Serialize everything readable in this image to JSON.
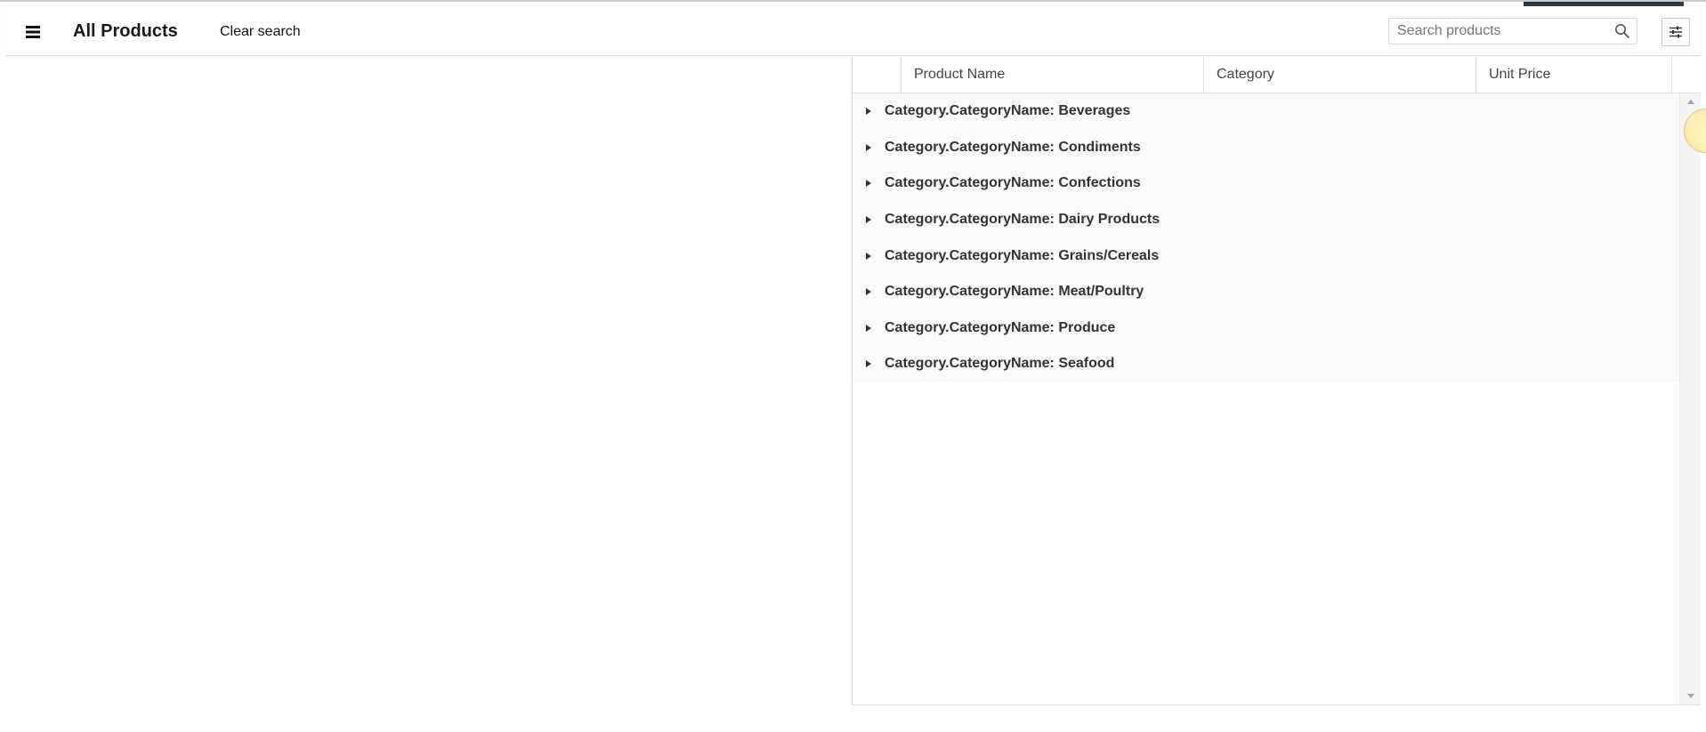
{
  "header": {
    "menu_icon": "hamburger-menu-icon",
    "title": "All Products",
    "clear_search_label": "Clear search",
    "search": {
      "placeholder": "Search products",
      "value": "",
      "icon": "search-icon"
    },
    "settings_icon": "sliders-icon"
  },
  "grid": {
    "columns": [
      "Product Name",
      "Category",
      "Unit Price"
    ],
    "groups": [
      "Category.CategoryName: Beverages",
      "Category.CategoryName: Condiments",
      "Category.CategoryName: Confections",
      "Category.CategoryName: Dairy Products",
      "Category.CategoryName: Grains/Cereals",
      "Category.CategoryName: Meat/Poultry",
      "Category.CategoryName: Produce",
      "Category.CategoryName: Seafood"
    ]
  },
  "colors": {
    "accent_bar": "#2e3a44",
    "group_row_bg": "#fafafa",
    "border": "#e0e0e0"
  }
}
